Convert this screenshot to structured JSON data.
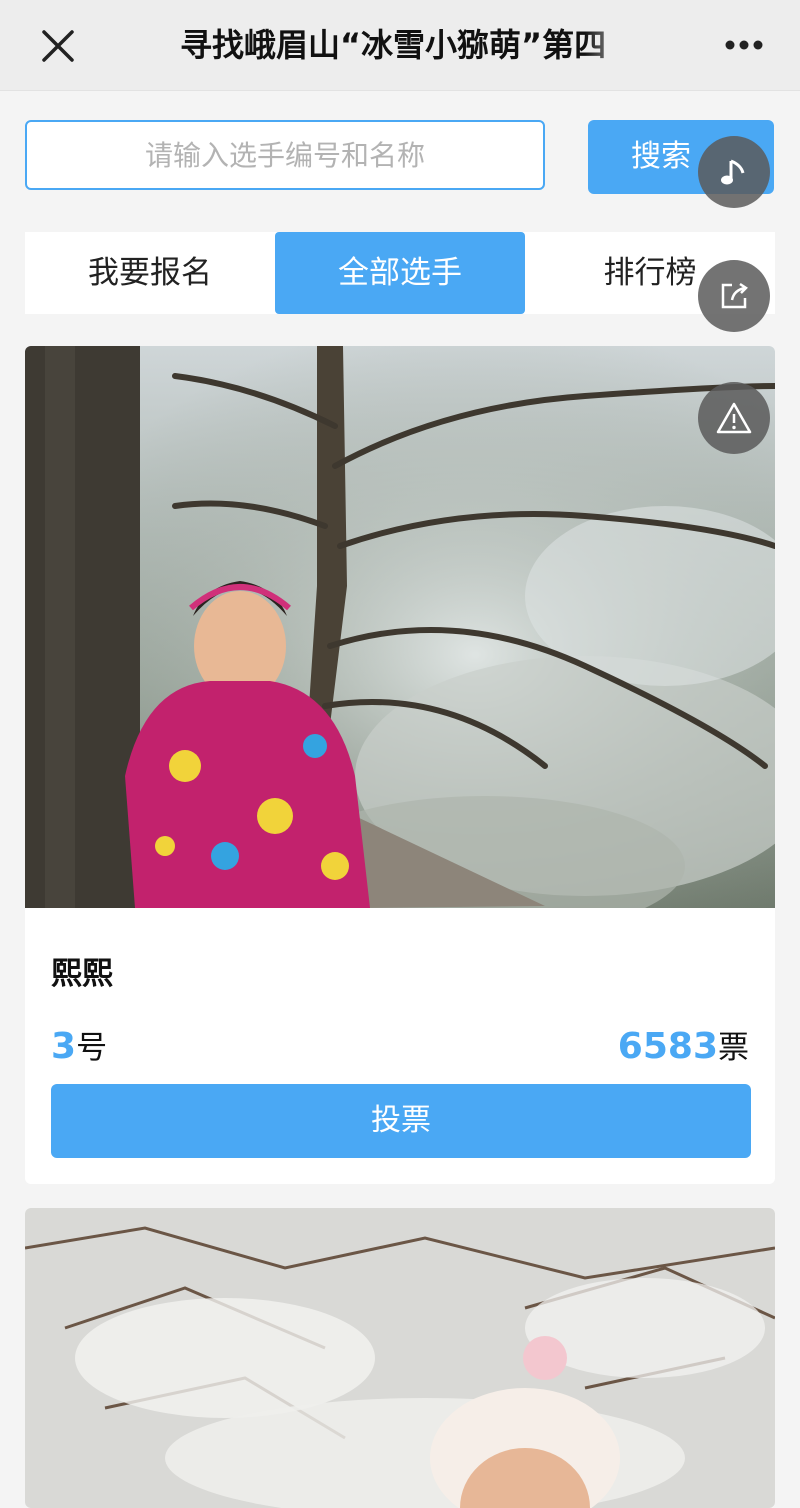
{
  "header": {
    "title": "寻找峨眉山“冰雪小猕萌”第四",
    "close_icon": "close-icon",
    "more_icon": "more-dots-icon"
  },
  "search": {
    "placeholder": "请输入选手编号和名称",
    "button_label": "搜索"
  },
  "tabs": [
    {
      "label": "我要报名",
      "active": false
    },
    {
      "label": "全部选手",
      "active": true
    },
    {
      "label": "排行榜",
      "active": false
    }
  ],
  "floating": {
    "music_icon": "music-note-icon",
    "share_icon": "share-icon",
    "report_icon": "warning-icon"
  },
  "contestants": [
    {
      "name": "熙熙",
      "number": "3",
      "number_suffix": "号",
      "votes": "6583",
      "votes_suffix": "票",
      "vote_label": "投票"
    }
  ],
  "colors": {
    "accent": "#4aa8f4",
    "background": "#f4f4f4",
    "topbar": "#ededed"
  }
}
